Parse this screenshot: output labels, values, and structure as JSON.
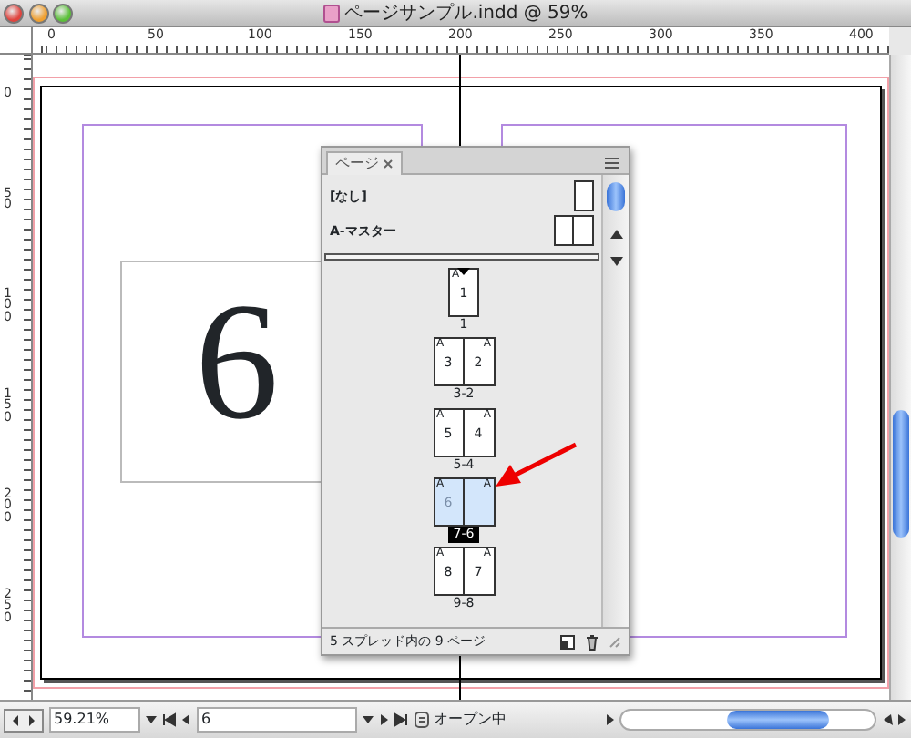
{
  "window": {
    "title": "ページサンプル.indd @ 59%"
  },
  "ruler": {
    "horizontal": [
      "0",
      "50",
      "100",
      "150",
      "200",
      "250",
      "300",
      "350",
      "400"
    ],
    "vertical": [
      "0",
      "50",
      "100",
      "150",
      "200",
      "250"
    ]
  },
  "document": {
    "frame_text": "6"
  },
  "pages_panel": {
    "tab": "ページ",
    "masters": [
      {
        "label": "[なし]",
        "kind": "single"
      },
      {
        "label": "A-マスター",
        "kind": "spread"
      }
    ],
    "spreads": [
      {
        "label": "1",
        "selected": false,
        "start_marker": true,
        "pages": [
          {
            "number": "1",
            "master": "A"
          }
        ]
      },
      {
        "label": "3-2",
        "selected": false,
        "start_marker": false,
        "pages": [
          {
            "number": "3",
            "master": "A"
          },
          {
            "number": "2",
            "master": "A"
          }
        ]
      },
      {
        "label": "5-4",
        "selected": false,
        "start_marker": false,
        "pages": [
          {
            "number": "5",
            "master": "A"
          },
          {
            "number": "4",
            "master": "A"
          }
        ]
      },
      {
        "label": "7-6",
        "selected": true,
        "start_marker": false,
        "pages": [
          {
            "number": "6",
            "master": "A"
          },
          {
            "master": "A"
          }
        ]
      },
      {
        "label": "9-8",
        "selected": false,
        "start_marker": false,
        "pages": [
          {
            "number": "8",
            "master": "A"
          },
          {
            "number": "7",
            "master": "A"
          }
        ]
      }
    ],
    "footer": "5 スプレッド内の 9 ページ"
  },
  "status_bar": {
    "zoom": "59.21%",
    "page": "6",
    "status": "オープン中"
  }
}
